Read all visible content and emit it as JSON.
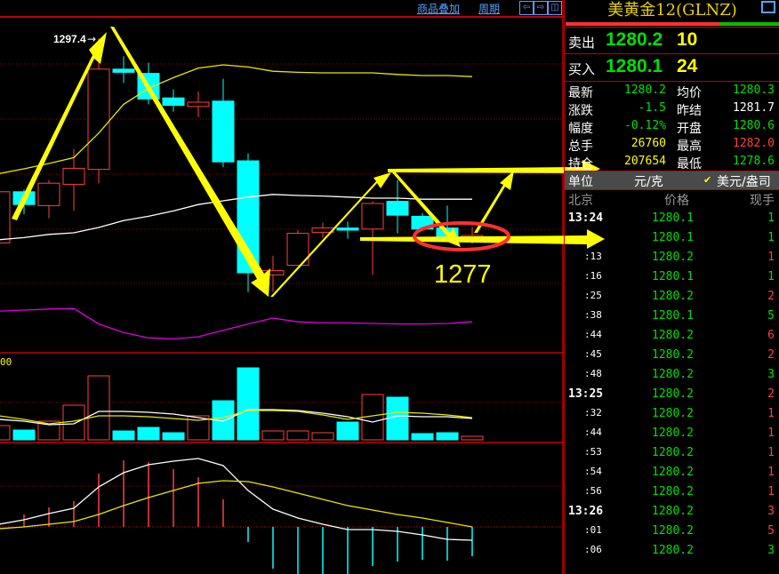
{
  "toolbar": {
    "overlay_label": "商品叠加",
    "period_label": "周期",
    "buttons": [
      "left-arrow-icon",
      "right-arrow-icon",
      "split-panel-icon"
    ]
  },
  "colors": {
    "up": "#ff4040",
    "down": "#00ffff",
    "bg": "#000000",
    "grid": "#c00000",
    "green": "#00e000",
    "yellow": "#ffff00",
    "ma_upper": "#e8e800",
    "ma_mid": "#ffffff",
    "ma_lower": "#e000e0"
  },
  "chart_data": [
    {
      "type": "candlestick",
      "high_label": "1297.4",
      "candles": [
        {
          "o": 1278.2,
          "h": 1283.0,
          "l": 1278.2,
          "c": 1283.0
        },
        {
          "o": 1283.0,
          "h": 1283.2,
          "l": 1280.9,
          "c": 1281.8
        },
        {
          "o": 1281.7,
          "h": 1284.1,
          "l": 1280.5,
          "c": 1283.8
        },
        {
          "o": 1283.7,
          "h": 1287.0,
          "l": 1281.2,
          "c": 1285.2
        },
        {
          "o": 1285.1,
          "h": 1297.4,
          "l": 1283.8,
          "c": 1294.5
        },
        {
          "o": 1294.5,
          "h": 1295.7,
          "l": 1293.2,
          "c": 1294.2
        },
        {
          "o": 1294.1,
          "h": 1295.1,
          "l": 1291.2,
          "c": 1291.7
        },
        {
          "o": 1291.8,
          "h": 1292.6,
          "l": 1290.5,
          "c": 1291.1
        },
        {
          "o": 1291.0,
          "h": 1292.4,
          "l": 1290.0,
          "c": 1291.4
        },
        {
          "o": 1291.5,
          "h": 1293.6,
          "l": 1285.3,
          "c": 1285.8
        },
        {
          "o": 1285.9,
          "h": 1286.6,
          "l": 1273.6,
          "c": 1275.4
        },
        {
          "o": 1275.2,
          "h": 1277.0,
          "l": 1273.6,
          "c": 1275.6
        },
        {
          "o": 1276.1,
          "h": 1279.4,
          "l": 1276.1,
          "c": 1279.1
        },
        {
          "o": 1279.2,
          "h": 1280.1,
          "l": 1278.7,
          "c": 1279.6
        },
        {
          "o": 1279.6,
          "h": 1280.2,
          "l": 1278.6,
          "c": 1279.4
        },
        {
          "o": 1279.5,
          "h": 1282.1,
          "l": 1275.2,
          "c": 1281.9
        },
        {
          "o": 1282.1,
          "h": 1284.1,
          "l": 1279.1,
          "c": 1280.8
        },
        {
          "o": 1280.7,
          "h": 1281.0,
          "l": 1279.5,
          "c": 1279.5
        },
        {
          "o": 1279.6,
          "h": 1281.7,
          "l": 1278.7,
          "c": 1278.7
        },
        {
          "o": 1278.8,
          "h": 1279.7,
          "l": 1278.1,
          "c": 1278.9
        }
      ],
      "lines": {
        "upper": [
          1284.7,
          1285.15,
          1285.65,
          1286.2,
          1288.5,
          1291.2,
          1292.7,
          1293.7,
          1294.6,
          1294.9,
          1294.7,
          1294.3,
          1294.2,
          1294.15,
          1294.15,
          1294.15,
          1294.0,
          1293.9,
          1293.9,
          1293.8
        ],
        "middle": [
          1278.5,
          1278.7,
          1279.0,
          1279.15,
          1279.65,
          1280.3,
          1280.7,
          1281.2,
          1281.8,
          1282.15,
          1282.5,
          1282.75,
          1282.65,
          1282.6,
          1282.5,
          1282.4,
          1282.4,
          1282.3,
          1282.3,
          1282.3
        ],
        "lower": [
          1271.8,
          1271.9,
          1272.0,
          1272.05,
          1270.6,
          1269.8,
          1269.3,
          1269.2,
          1269.4,
          1270.0,
          1270.6,
          1271.15,
          1270.8,
          1270.7,
          1270.7,
          1270.65,
          1270.6,
          1270.6,
          1270.65,
          1270.8
        ]
      },
      "annotation_label": "1277"
    },
    {
      "type": "bar",
      "label": "00",
      "volumes": [
        16,
        11,
        21,
        39,
        72,
        10,
        14,
        8,
        27,
        44,
        81,
        10,
        10,
        8,
        20,
        51,
        48,
        7,
        8,
        4
      ],
      "ma_white": [
        23,
        21,
        17,
        18,
        32,
        32,
        31,
        29,
        25,
        21,
        34,
        34,
        33,
        30,
        26,
        20,
        27,
        26,
        26,
        24
      ],
      "ma_yellow": [
        27,
        23,
        18,
        21,
        27,
        27,
        26,
        24,
        22,
        25,
        33,
        33,
        32,
        28,
        23,
        27,
        31,
        30,
        28,
        25
      ]
    },
    {
      "type": "bar",
      "histogram": [
        null,
        14,
        22,
        29,
        60,
        75,
        73,
        65,
        56,
        31,
        -17,
        -47,
        -53,
        -53,
        -53,
        -44,
        -39,
        -37,
        -38,
        -33
      ],
      "dif": [
        3,
        8,
        15,
        21,
        45,
        61,
        70,
        74,
        77,
        69,
        41,
        20,
        10,
        3,
        -3,
        -3,
        -5,
        -9,
        -14,
        -15
      ],
      "dea": [
        -2,
        0,
        3,
        6,
        14,
        24,
        33,
        41,
        49,
        52,
        51,
        45,
        38,
        31,
        24,
        19,
        14,
        10,
        5,
        0
      ]
    }
  ],
  "quote": {
    "title": "美黄金12(GLNZ)",
    "buy_ratio": 0.72,
    "sell": {
      "label": "卖出",
      "price": "1280.2",
      "volume": "10"
    },
    "buy": {
      "label": "买入",
      "price": "1280.1",
      "volume": "24"
    },
    "stats": [
      {
        "l1": "最新",
        "v1": "1280.2",
        "c1": "#00e000",
        "l2": "均价",
        "v2": "1280.3",
        "c2": "#00e000"
      },
      {
        "l1": "涨跌",
        "v1": "-1.5",
        "c1": "#00e000",
        "l2": "昨结",
        "v2": "1281.7",
        "c2": "#ffffff"
      },
      {
        "l1": "幅度",
        "v1": "-0.12%",
        "c1": "#00e000",
        "l2": "开盘",
        "v2": "1280.6",
        "c2": "#00e000"
      },
      {
        "l1": "总手",
        "v1": "26760",
        "c1": "#ffff00",
        "l2": "最高",
        "v2": "1282.0",
        "c2": "#ff4040"
      },
      {
        "l1": "持仓",
        "v1": "207654",
        "c1": "#ffff00",
        "l2": "最低",
        "v2": "1278.6",
        "c2": "#00e000"
      }
    ],
    "unit": {
      "label": "单位",
      "opt1": "元/克",
      "opt2": "美元/盎司",
      "selected": "美元/盎司"
    },
    "headers": {
      "time": "北京",
      "price": "价格",
      "vol": "现手"
    }
  },
  "ticks": [
    {
      "t": "13:24",
      "p": "1280.1",
      "v": "1",
      "up": false
    },
    {
      "t": "",
      "p": "1280.1",
      "v": "1",
      "up": false
    },
    {
      "t": ":13",
      "p": "1280.2",
      "v": "1",
      "up": true
    },
    {
      "t": ":16",
      "p": "1280.1",
      "v": "1",
      "up": false
    },
    {
      "t": ":25",
      "p": "1280.2",
      "v": "2",
      "up": true
    },
    {
      "t": ":38",
      "p": "1280.1",
      "v": "5",
      "up": false
    },
    {
      "t": ":44",
      "p": "1280.2",
      "v": "6",
      "up": true
    },
    {
      "t": ":45",
      "p": "1280.2",
      "v": "2",
      "up": true
    },
    {
      "t": ":48",
      "p": "1280.2",
      "v": "3",
      "up": false
    },
    {
      "t": "13:25",
      "p": "1280.2",
      "v": "2",
      "up": true
    },
    {
      "t": ":32",
      "p": "1280.2",
      "v": "1",
      "up": true
    },
    {
      "t": ":44",
      "p": "1280.2",
      "v": "1",
      "up": true
    },
    {
      "t": ":53",
      "p": "1280.2",
      "v": "1",
      "up": true
    },
    {
      "t": ":54",
      "p": "1280.2",
      "v": "1",
      "up": true
    },
    {
      "t": ":56",
      "p": "1280.2",
      "v": "1",
      "up": true
    },
    {
      "t": "13:26",
      "p": "1280.2",
      "v": "3",
      "up": true
    },
    {
      "t": ":01",
      "p": "1280.2",
      "v": "5",
      "up": true
    },
    {
      "t": ":06",
      "p": "1280.2",
      "v": "3",
      "up": false
    }
  ]
}
